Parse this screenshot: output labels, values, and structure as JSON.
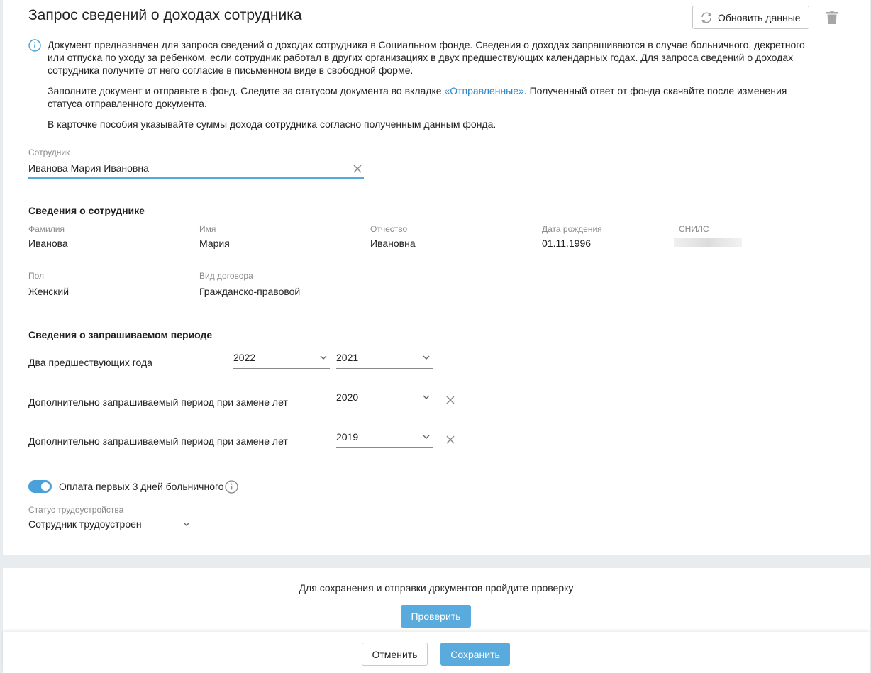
{
  "header": {
    "title": "Запрос сведений о доходах сотрудника",
    "refresh_label": "Обновить данные"
  },
  "info": {
    "p1": "Документ предназначен для запроса сведений о доходах сотрудника в Социальном фонде. Сведения о доходах запрашиваются в случае больничного, декретного или отпуска по уходу за ребенком, если сотрудник работал в других организациях в двух предшествующих календарных годах. Для запроса сведений о доходах сотрудника получите от него согласие в письменном виде в свободной форме.",
    "p2_before": "Заполните документ и отправьте в фонд. Следите за статусом документа во вкладке ",
    "p2_link": "«Отправленные»",
    "p2_after": ". Полученный ответ от фонда скачайте после изменения статуса отправленного документа.",
    "p3": "В карточке пособия указывайте суммы дохода сотрудника согласно полученным данным фонда."
  },
  "employee": {
    "label": "Сотрудник",
    "value": "Иванова Мария Ивановна"
  },
  "employee_info": {
    "section_title": "Сведения о сотруднике",
    "last_name_label": "Фамилия",
    "last_name": "Иванова",
    "first_name_label": "Имя",
    "first_name": "Мария",
    "patronymic_label": "Отчество",
    "patronymic": "Ивановна",
    "birth_label": "Дата рождения",
    "birth": "01.11.1996",
    "snils_label": "СНИЛС",
    "gender_label": "Пол",
    "gender": "Женский",
    "contract_label": "Вид договора",
    "contract": "Гражданско-правовой"
  },
  "period": {
    "section_title": "Сведения о запрашиваемом периоде",
    "two_years_label": "Два предшествующих года",
    "year1": "2022",
    "year2": "2021",
    "extra_label_1": "Дополнительно запрашиваемый период при замене лет",
    "extra_year_1": "2020",
    "extra_label_2": "Дополнительно запрашиваемый период при замене лет",
    "extra_year_2": "2019"
  },
  "sick_pay": {
    "toggle_label": "Оплата первых 3 дней больничного",
    "toggle_on": true
  },
  "employment": {
    "label": "Статус трудоустройства",
    "value": "Сотрудник трудоустроен"
  },
  "check": {
    "text": "Для сохранения и отправки документов пройдите проверку",
    "button": "Проверить"
  },
  "footer": {
    "cancel": "Отменить",
    "save": "Сохранить"
  },
  "colors": {
    "accent": "#5aabdd",
    "link": "#2e86c7"
  }
}
